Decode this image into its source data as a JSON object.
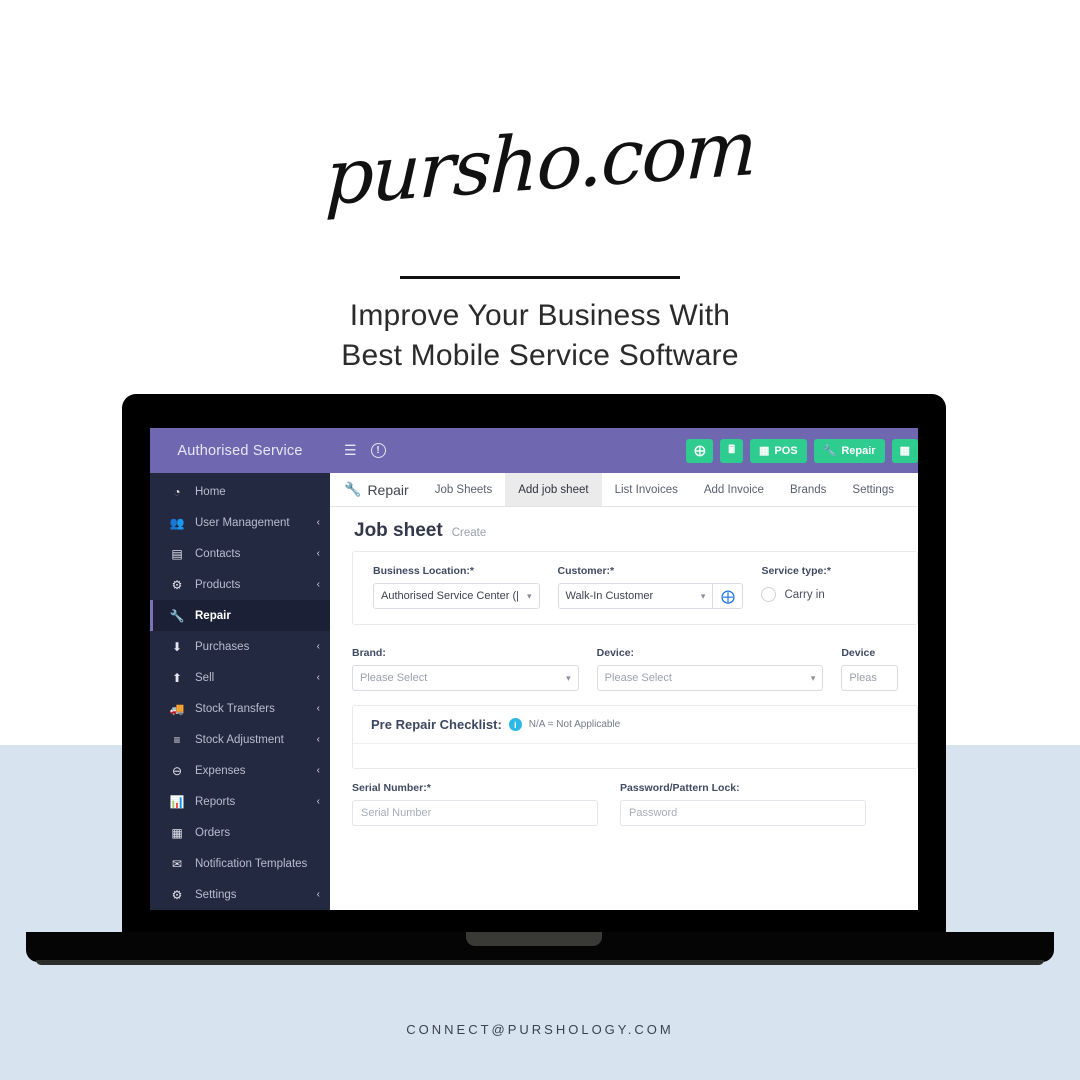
{
  "brand": {
    "logo_text": "pursho.com",
    "headline_line1": "Improve Your Business With",
    "headline_line2": "Best Mobile Service Software",
    "footer_email": "CONNECT@PURSHOLOGY.COM"
  },
  "sidebar": {
    "brand_title": "Authorised Service",
    "items": [
      {
        "label": "Home",
        "icon": "dashboard-icon",
        "glyph": "◔",
        "chevron": "",
        "active": false
      },
      {
        "label": "User Management",
        "icon": "users-icon",
        "glyph": "὆5",
        "chevron": "‹",
        "active": false
      },
      {
        "label": "Contacts",
        "icon": "contacts-icon",
        "glyph": "▤",
        "chevron": "‹",
        "active": false
      },
      {
        "label": "Products",
        "icon": "products-icon",
        "glyph": "⚙",
        "chevron": "‹",
        "active": false
      },
      {
        "label": "Repair",
        "icon": "wrench-icon",
        "glyph": "ὒ7",
        "chevron": "",
        "active": true
      },
      {
        "label": "Purchases",
        "icon": "download-circle-icon",
        "glyph": "⬇",
        "chevron": "‹",
        "active": false
      },
      {
        "label": "Sell",
        "icon": "upload-circle-icon",
        "glyph": "⬆",
        "chevron": "‹",
        "active": false
      },
      {
        "label": "Stock Transfers",
        "icon": "truck-icon",
        "glyph": "Ὡa",
        "chevron": "‹",
        "active": false
      },
      {
        "label": "Stock Adjustment",
        "icon": "database-icon",
        "glyph": "≡",
        "chevron": "‹",
        "active": false
      },
      {
        "label": "Expenses",
        "icon": "minus-circle-icon",
        "glyph": "⊖",
        "chevron": "‹",
        "active": false
      },
      {
        "label": "Reports",
        "icon": "bar-chart-icon",
        "glyph": "Ὄa",
        "chevron": "‹",
        "active": false
      },
      {
        "label": "Orders",
        "icon": "table-icon",
        "glyph": "▦",
        "chevron": "",
        "active": false
      },
      {
        "label": "Notification Templates",
        "icon": "envelope-icon",
        "glyph": "✉",
        "chevron": "",
        "active": false
      },
      {
        "label": "Settings",
        "icon": "gear-icon",
        "glyph": "⚙",
        "chevron": "‹",
        "active": false
      }
    ]
  },
  "topbar": {
    "menu_icon": "hamburger-icon",
    "info_icon": "info-icon",
    "info_glyph": "!",
    "buttons": [
      {
        "label": "",
        "icon": "plus-icon",
        "glyph": "⊕"
      },
      {
        "label": "",
        "icon": "calculator-icon",
        "glyph": "὚9"
      },
      {
        "label": "POS",
        "icon": "grid-icon",
        "glyph": "▦"
      },
      {
        "label": "Repair",
        "icon": "wrench-icon",
        "glyph": "ὒ7"
      },
      {
        "label": "",
        "icon": "partial-icon",
        "glyph": "▦"
      }
    ]
  },
  "tabs": {
    "section_title": "Repair",
    "section_icon": "wrench-icon",
    "items": [
      {
        "label": "Job Sheets",
        "active": false
      },
      {
        "label": "Add job sheet",
        "active": true
      },
      {
        "label": "List Invoices",
        "active": false
      },
      {
        "label": "Add Invoice",
        "active": false
      },
      {
        "label": "Brands",
        "active": false
      },
      {
        "label": "Settings",
        "active": false
      }
    ]
  },
  "page": {
    "title": "Job sheet",
    "subtitle": "Create"
  },
  "form": {
    "business_location": {
      "label": "Business Location:*",
      "value": "Authorised Service Center (|"
    },
    "customer": {
      "label": "Customer:*",
      "value": "Walk-In Customer",
      "add_icon": "plus-circle-icon"
    },
    "service_type": {
      "label": "Service type:*",
      "option_label": "Carry in",
      "selected": false
    },
    "brand": {
      "label": "Brand:",
      "value": "Please Select"
    },
    "device": {
      "label": "Device:",
      "value": "Please Select"
    },
    "device_model": {
      "label": "Device",
      "value": "Pleas"
    },
    "checklist": {
      "title": "Pre Repair Checklist:",
      "info_glyph": "i",
      "note": "N/A = Not Applicable"
    },
    "serial_number": {
      "label": "Serial Number:*",
      "placeholder": "Serial Number",
      "value": ""
    },
    "password_lock": {
      "label": "Password/Pattern Lock:",
      "placeholder": "Password",
      "value": ""
    }
  },
  "colors": {
    "purple": "#6f68b0",
    "sidebar": "#242942",
    "sidebar_active": "#1b2036",
    "green": "#2ecc8f",
    "bg_lower": "#d7e3ee",
    "accent_blue": "#1e73e8"
  }
}
